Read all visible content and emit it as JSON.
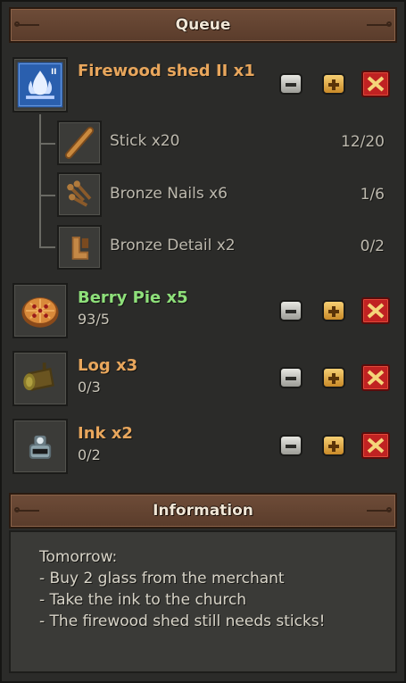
{
  "queue_header": {
    "title": "Queue"
  },
  "queue": [
    {
      "name": "Firewood shed II x1",
      "icon": "firewood-shed-icon",
      "name_color": "#e8a65c",
      "components": [
        {
          "name": "Stick x20",
          "progress": "12/20",
          "icon": "stick-icon"
        },
        {
          "name": "Bronze Nails x6",
          "progress": "1/6",
          "icon": "bronze-nails-icon"
        },
        {
          "name": "Bronze Detail x2",
          "progress": "0/2",
          "icon": "bronze-detail-icon"
        }
      ]
    },
    {
      "name": "Berry Pie x5",
      "count": "93/5",
      "icon": "berry-pie-icon",
      "name_color": "#8ee07a"
    },
    {
      "name": "Log x3",
      "count": "0/3",
      "icon": "log-icon",
      "name_color": "#e8a65c"
    },
    {
      "name": "Ink x2",
      "count": "0/2",
      "icon": "ink-icon",
      "name_color": "#e8a65c"
    }
  ],
  "info_header": {
    "title": "Information"
  },
  "information": {
    "text": "Tomorrow:\n- Buy 2 glass from the merchant\n- Take the ink to the church\n- The firewood shed still needs sticks!"
  }
}
